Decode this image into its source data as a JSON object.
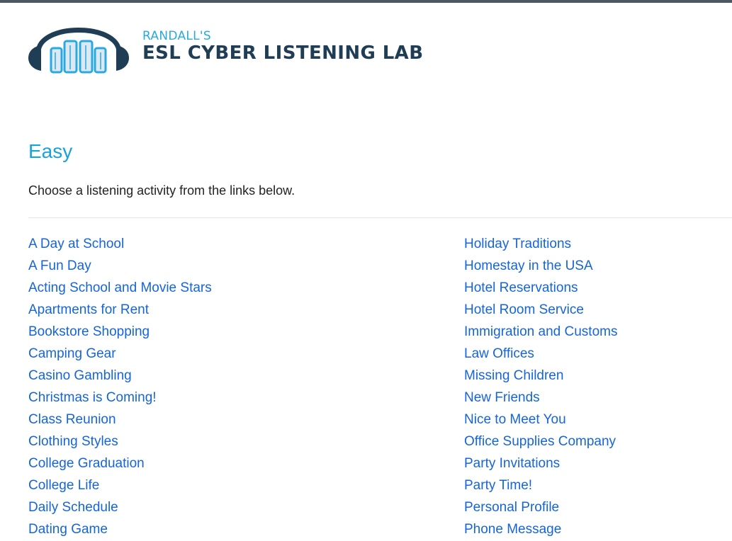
{
  "brand": {
    "subtitle": "RANDALL'S",
    "title": "ESL CYBER LISTENING LAB"
  },
  "colors": {
    "accent": "#1aa3d9",
    "brand_dark": "#1f3d55",
    "link": "#1565d8"
  },
  "page": {
    "level_title": "Easy",
    "intro": "Choose a listening activity from the links below."
  },
  "activities": {
    "left": [
      "A Day at School",
      "A Fun Day",
      "Acting School and Movie Stars",
      "Apartments for Rent",
      "Bookstore Shopping",
      "Camping Gear",
      "Casino Gambling",
      "Christmas is Coming!",
      "Class Reunion",
      "Clothing Styles",
      "College Graduation",
      "College Life",
      "Daily Schedule",
      "Dating Game"
    ],
    "right": [
      "Holiday Traditions",
      "Homestay in the USA",
      "Hotel Reservations",
      "Hotel Room Service",
      "Immigration and Customs",
      "Law Offices",
      "Missing Children",
      "New Friends",
      "Nice to Meet You",
      "Office Supplies Company",
      "Party Invitations",
      "Party Time!",
      "Personal Profile",
      "Phone Message"
    ]
  }
}
